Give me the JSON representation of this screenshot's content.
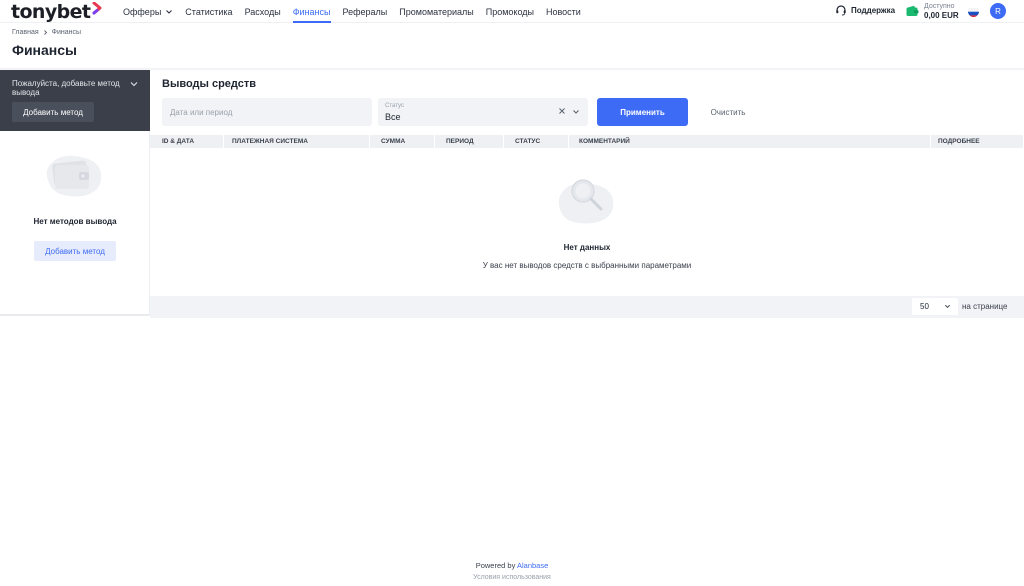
{
  "brand": {
    "logo_text": "tonybet"
  },
  "nav": {
    "items": [
      {
        "label": "Офферы"
      },
      {
        "label": "Статистика"
      },
      {
        "label": "Расходы"
      },
      {
        "label": "Финансы"
      },
      {
        "label": "Рефералы"
      },
      {
        "label": "Промоматериалы"
      },
      {
        "label": "Промокоды"
      },
      {
        "label": "Новости"
      }
    ],
    "active": "Финансы"
  },
  "header": {
    "support_label": "Поддержка",
    "balance_label": "Доступно",
    "balance_value": "0,00 EUR",
    "language_flag": "ru-flag-icon",
    "avatar_letter": "R"
  },
  "breadcrumb": {
    "home": "Главная",
    "current": "Финансы"
  },
  "page_title": "Финансы",
  "left_panel": {
    "prompt": "Пожалуйста, добавьте метод вывода",
    "add_button": "Добавить метод",
    "empty_text": "Нет методов вывода",
    "empty_add_button": "Добавить метод"
  },
  "withdrawals": {
    "title": "Выводы средств",
    "date_placeholder": "Дата или период",
    "status_label": "Статус",
    "status_value": "Все",
    "apply_button": "Применить",
    "clear_button": "Очистить",
    "columns": [
      "ID & ДАТА",
      "ПЛАТЕЖНАЯ СИСТЕМА",
      "СУММА",
      "ПЕРИОД",
      "СТАТУС",
      "КОММЕНТАРИЙ",
      "ПОДРОБНЕЕ"
    ],
    "empty_title": "Нет данных",
    "empty_subtitle": "У вас нет выводов средств с выбранными параметрами",
    "per_page_value": "50",
    "per_page_label": "на странице"
  },
  "footer": {
    "powered_by": "Powered by",
    "powered_brand": "Alanbase",
    "terms": "Условия использования"
  },
  "colors": {
    "accent": "#3d6bf5",
    "dark_panel": "#3a3f49",
    "logo_red": "#e8384f",
    "logo_purple": "#7b3ff2"
  }
}
